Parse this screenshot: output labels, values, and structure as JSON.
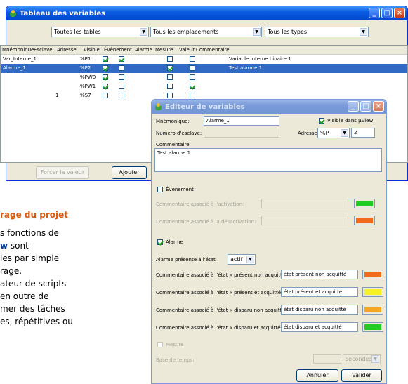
{
  "background": {
    "heading": "rage du projet",
    "lines": [
      {
        "pre": "s fonctions de",
        "bold": "",
        "post": ""
      },
      {
        "pre": "",
        "bold": "w",
        "post": " sont"
      },
      {
        "pre": "les par simple",
        "bold": "",
        "post": ""
      },
      {
        "pre": "rage.",
        "bold": "",
        "post": ""
      },
      {
        "pre": "ateur de scripts",
        "bold": "",
        "post": ""
      },
      {
        "pre": "en outre de",
        "bold": "",
        "post": ""
      },
      {
        "pre": "mer des tâches",
        "bold": "",
        "post": ""
      },
      {
        "pre": "es, répétitives ou",
        "bold": "",
        "post": ""
      }
    ]
  },
  "main_window": {
    "title": "Tableau des variables",
    "filters": {
      "tables": "Toutes les tables",
      "emplacements": "Tous les emplacements",
      "types": "Tous les types"
    },
    "columns": [
      "Mnémonique",
      "Esclave",
      "Adresse",
      "Visible",
      "Évènement",
      "Alarme",
      "Mesure",
      "Valeur",
      "Commentaire"
    ],
    "rows": [
      {
        "mnemonique": "Var_Interne_1",
        "esclave": "",
        "adresse": "%P1",
        "visible": true,
        "evenement": true,
        "alarme": false,
        "mesure": false,
        "valeur": "",
        "commentaire": "Variable Interne binaire 1"
      },
      {
        "mnemonique": "Alarme_1",
        "esclave": "",
        "adresse": "%P2",
        "visible": true,
        "evenement": false,
        "alarme": true,
        "mesure": false,
        "valeur": "",
        "commentaire": "Test alarme 1"
      },
      {
        "mnemonique": "",
        "esclave": "",
        "adresse": "%PW0",
        "visible": true,
        "evenement": false,
        "alarme": false,
        "mesure": false,
        "valeur": "",
        "commentaire": ""
      },
      {
        "mnemonique": "",
        "esclave": "",
        "adresse": "%PW1",
        "visible": true,
        "evenement": false,
        "alarme": false,
        "mesure": true,
        "valeur": "",
        "commentaire": ""
      },
      {
        "mnemonique": "",
        "esclave": "1",
        "adresse": "%S7",
        "visible": false,
        "evenement": false,
        "alarme": false,
        "mesure": false,
        "valeur": "",
        "commentaire": ""
      }
    ],
    "buttons": {
      "force": "Forcer la valeur",
      "add": "Ajouter"
    }
  },
  "editor": {
    "title": "Editeur de variables",
    "mnemonique_label": "Mnémonique:",
    "mnemonique_value": "Alarme_1",
    "visible_label": "Visible dans µView",
    "visible_checked": true,
    "esclave_label": "Numéro d'esclave:",
    "esclave_value": "",
    "adresse_label": "Adresse:",
    "adresse_type": "%P",
    "adresse_value": "2",
    "commentaire_label": "Commentaire:",
    "commentaire_value": "Test alarme 1",
    "evenement_label": "Évènement",
    "evenement_checked": false,
    "activation_label": "Commentaire associé à l'activation:",
    "desactivation_label": "Commentaire associé à la désactivation:",
    "activation_color": "#22cc22",
    "desactivation_color": "#f26a1b",
    "alarme_label": "Alarme",
    "alarme_checked": true,
    "etat_label": "Alarme présente à l'état",
    "etat_value": "actif",
    "states": [
      {
        "label": "Commentaire associé à l'état « présent non acquitté »:",
        "value": "état présent non acquitté",
        "color": "#f26a1b"
      },
      {
        "label": "Commentaire associé à l'état « présent et acquitté »:",
        "value": "état présent et acquitté",
        "color": "#f5f224"
      },
      {
        "label": "Commentaire associé à l'état « disparu non acquitté »:",
        "value": "état disparu non acquitté",
        "color": "#f5a623"
      },
      {
        "label": "Commentaire associé à l'état « disparu et acquitté »:",
        "value": "état disparu et acquitté",
        "color": "#22cc22"
      }
    ],
    "mesure_label": "Mesure",
    "base_label": "Base de temps:",
    "base_unit": "secondes",
    "cancel": "Annuler",
    "ok": "Valider"
  }
}
